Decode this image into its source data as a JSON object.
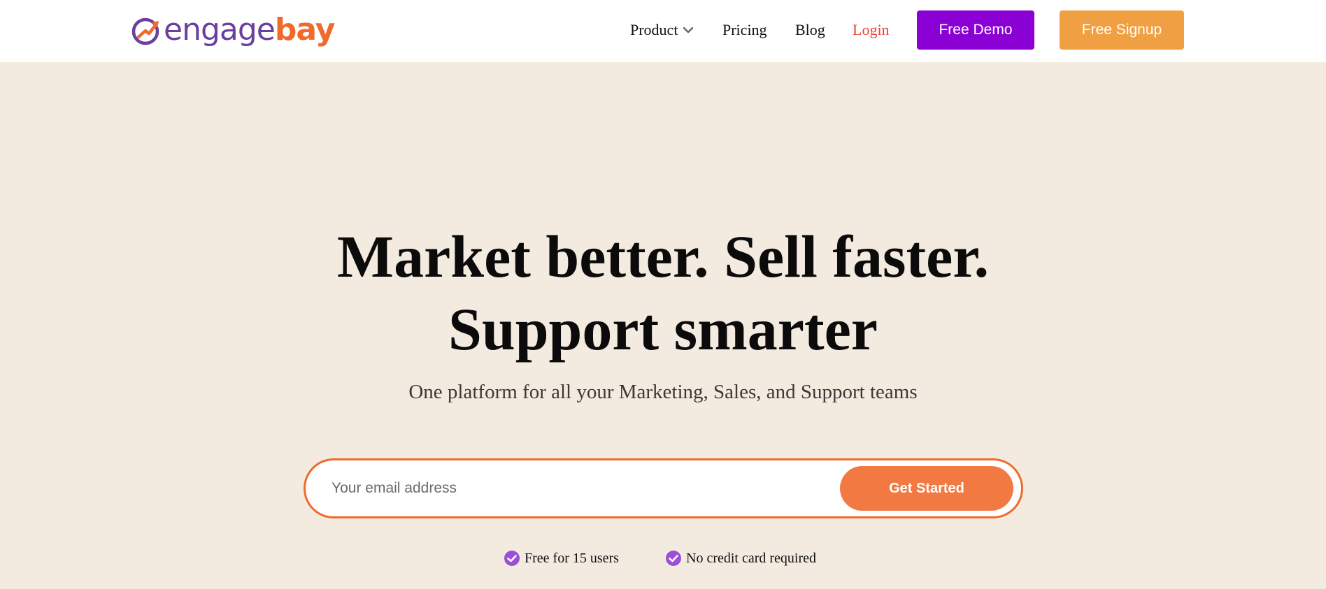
{
  "brand": {
    "logo_part1": "engage",
    "logo_part2": "bay",
    "colors": {
      "purple": "#6b3fa0",
      "orange": "#f06a2c"
    }
  },
  "nav": {
    "product": "Product",
    "pricing": "Pricing",
    "blog": "Blog",
    "login": "Login",
    "product_icon": "chevron-down-icon"
  },
  "buttons": {
    "free_demo": "Free Demo",
    "free_signup": "Free Signup",
    "demo_color": "#8b00d4",
    "signup_color": "#f0a042"
  },
  "hero": {
    "title_line1": "Market better. Sell faster.",
    "title_line2": "Support smarter",
    "subtitle": "One platform for all your Marketing, Sales, and Support teams"
  },
  "signup_form": {
    "email_placeholder": "Your email address",
    "submit_label": "Get Started",
    "accent": "#f27a42"
  },
  "perks": [
    {
      "label": "Free for 15 users",
      "icon": "check-circle-icon"
    },
    {
      "label": "No credit card required",
      "icon": "check-circle-icon"
    }
  ],
  "colors": {
    "page_bg": "#f4ebe0",
    "header_bg": "#ffffff",
    "login_text": "#e8443a",
    "check": "#9b4fd6"
  }
}
